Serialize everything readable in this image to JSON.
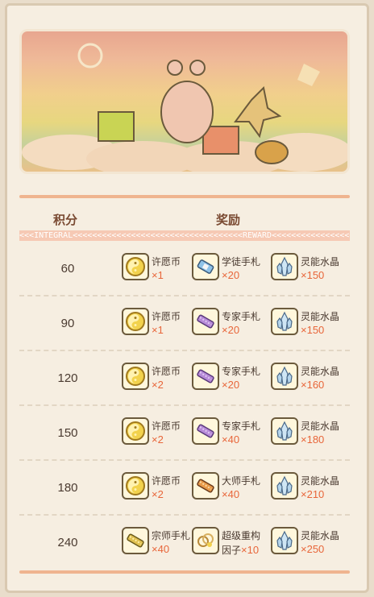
{
  "headers": {
    "score": "积分",
    "reward": "奖励",
    "integral": "INTEGRAL",
    "reward_en": "REWARD"
  },
  "rows": [
    {
      "score": "60",
      "rewards": [
        {
          "name": "许愿币",
          "qty": "×1",
          "icon": "coin-icon"
        },
        {
          "name": "学徒手札",
          "qty": "×20",
          "icon": "scroll-blue-icon"
        },
        {
          "name": "灵能水晶",
          "qty": "×150",
          "icon": "crystal-icon"
        }
      ]
    },
    {
      "score": "90",
      "rewards": [
        {
          "name": "许愿币",
          "qty": "×1",
          "icon": "coin-icon"
        },
        {
          "name": "专家手札",
          "qty": "×20",
          "icon": "scroll-purple-icon"
        },
        {
          "name": "灵能水晶",
          "qty": "×150",
          "icon": "crystal-icon"
        }
      ]
    },
    {
      "score": "120",
      "rewards": [
        {
          "name": "许愿币",
          "qty": "×2",
          "icon": "coin-icon"
        },
        {
          "name": "专家手札",
          "qty": "×20",
          "icon": "scroll-purple-icon"
        },
        {
          "name": "灵能水晶",
          "qty": "×160",
          "icon": "crystal-icon"
        }
      ]
    },
    {
      "score": "150",
      "rewards": [
        {
          "name": "许愿币",
          "qty": "×2",
          "icon": "coin-icon"
        },
        {
          "name": "专家手札",
          "qty": "×40",
          "icon": "scroll-purple-icon"
        },
        {
          "name": "灵能水晶",
          "qty": "×180",
          "icon": "crystal-icon"
        }
      ]
    },
    {
      "score": "180",
      "rewards": [
        {
          "name": "许愿币",
          "qty": "×2",
          "icon": "coin-icon"
        },
        {
          "name": "大师手札",
          "qty": "×40",
          "icon": "scroll-orange-icon"
        },
        {
          "name": "灵能水晶",
          "qty": "×210",
          "icon": "crystal-icon"
        }
      ]
    },
    {
      "score": "240",
      "rewards": [
        {
          "name": "宗师手札",
          "qty": "×40",
          "icon": "scroll-gold-icon"
        },
        {
          "name": "超级重构",
          "name2": "因子",
          "qty": "×10",
          "icon": "factor-icon"
        },
        {
          "name": "灵能水晶",
          "qty": "×250",
          "icon": "crystal-icon"
        }
      ]
    }
  ],
  "colors": {
    "accent": "#e8663a",
    "separator": "#efb48f",
    "header_text": "#7a4a32"
  }
}
